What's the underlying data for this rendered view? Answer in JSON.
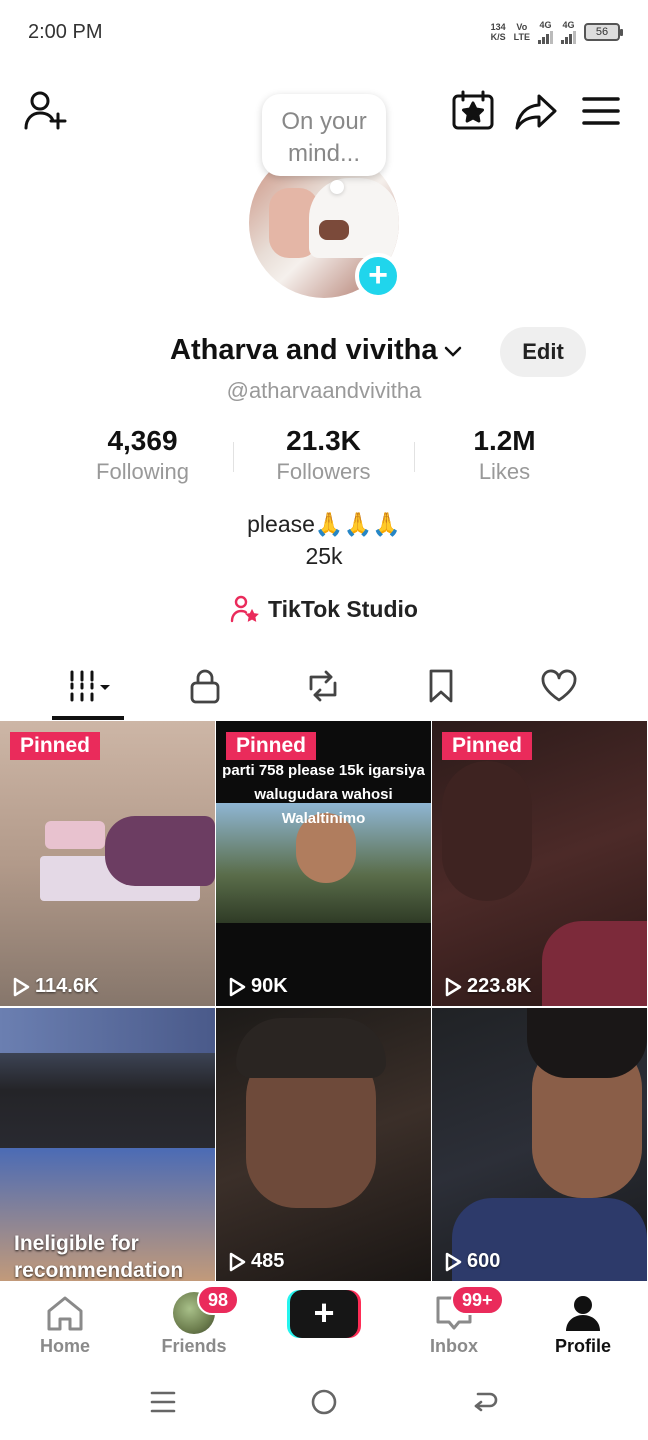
{
  "status_bar": {
    "time": "2:00 PM",
    "net_speed_top": "134",
    "net_speed_bottom": "K/S",
    "volte_top": "Vo",
    "volte_bottom": "LTE",
    "signal1_label": "4G",
    "signal2_label": "4G",
    "battery": "56"
  },
  "header": {
    "add_friend_icon": "person-plus-icon",
    "calendar_icon": "calendar-star-icon",
    "share_icon": "share-arrow-icon",
    "menu_icon": "hamburger-menu-icon",
    "thought_bubble": "On your mind..."
  },
  "profile": {
    "name": "Atharva and vivitha",
    "edit_label": "Edit",
    "handle": "@atharvaandvivitha"
  },
  "stats": [
    {
      "value": "4,369",
      "label": "Following"
    },
    {
      "value": "21.3K",
      "label": "Followers"
    },
    {
      "value": "1.2M",
      "label": "Likes"
    }
  ],
  "bio": {
    "line1": "please🙏🙏🙏",
    "line2": "25k"
  },
  "studio_label": "TikTok Studio",
  "videos": [
    {
      "pinned": "Pinned",
      "views": "114.6K",
      "caption": ""
    },
    {
      "pinned": "Pinned",
      "views": "90K",
      "caption": "parti 758 please 15k igarsiya walugudara wahosi Walaltinimo"
    },
    {
      "pinned": "Pinned",
      "views": "223.8K",
      "caption": ""
    },
    {
      "pinned": "",
      "views": "",
      "caption": "Ineligible for recommendation"
    },
    {
      "pinned": "",
      "views": "485",
      "caption": ""
    },
    {
      "pinned": "",
      "views": "600",
      "caption": ""
    }
  ],
  "video2_caption_line1": "parti 758 please 15k igarsiya",
  "video2_caption_line2": "walugudara wahosi Walaltinimo",
  "video4_line1": "Ineligible for",
  "video4_line2": "recommendation",
  "bottom_nav": {
    "home": "Home",
    "friends": "Friends",
    "friends_badge": "98",
    "inbox": "Inbox",
    "inbox_badge": "99+",
    "profile": "Profile"
  },
  "colors": {
    "accent": "#ea2b5b",
    "avatar_plus": "#20d5ec"
  }
}
